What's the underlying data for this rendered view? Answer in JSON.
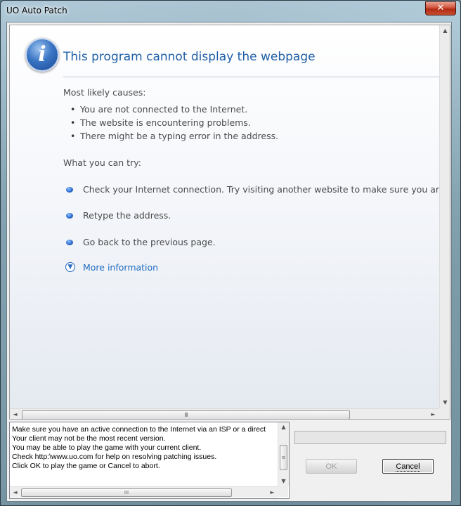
{
  "window": {
    "title": "UO Auto Patch",
    "close_glyph": "✕"
  },
  "browser": {
    "error_title": "This program cannot display the webpage",
    "causes_heading": "Most likely causes:",
    "causes": [
      "You are not connected to the Internet.",
      "The website is encountering problems.",
      "There might be a typing error in the address."
    ],
    "try_heading": "What you can try:",
    "tips": [
      "Check your Internet connection. Try visiting another website to make sure you are c",
      "Retype the address.",
      "Go back to the previous page."
    ],
    "more_info": "More information",
    "scroll_grip": "III"
  },
  "message": {
    "lines": [
      "Make sure you have an active connection to the Internet via an ISP or a direct",
      "Your client may not be the most recent version.",
      "You may be able to play the game with your current client.",
      "Check http:\\www.uo.com for help on resolving patching issues.",
      "Click OK to play the game or Cancel to abort."
    ],
    "scroll_grip": "III"
  },
  "progress": {
    "value": 0
  },
  "buttons": {
    "ok": "OK",
    "cancel": "Cancel"
  },
  "icons": {
    "info": "info-icon",
    "more": "chevron-down-circle-icon",
    "scroll_up": "▲",
    "scroll_down": "▼",
    "scroll_left": "◄",
    "scroll_right": "►"
  },
  "colors": {
    "title_blue": "#1f5fa8",
    "link_blue": "#1f6cc0",
    "close_red": "#c84e30"
  }
}
